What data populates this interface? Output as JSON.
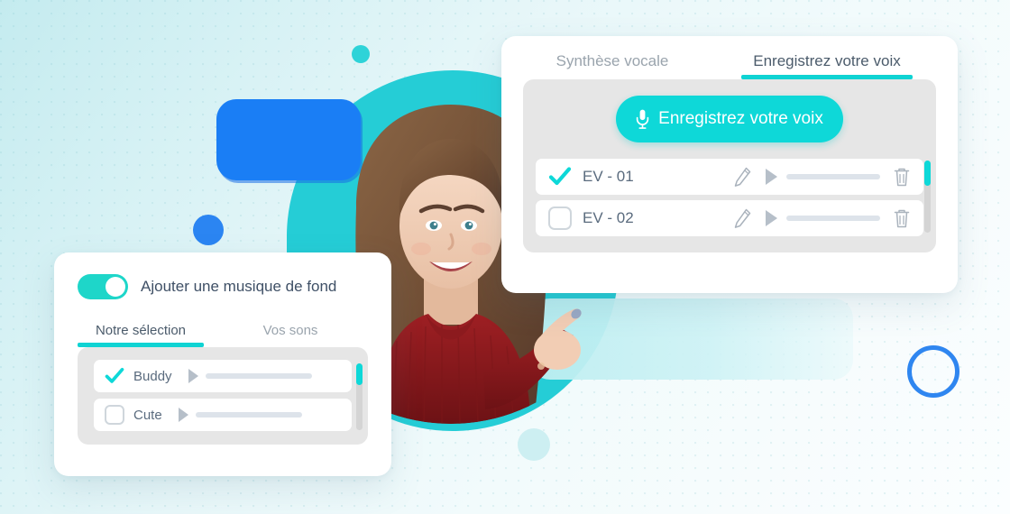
{
  "voice_card": {
    "tabs": [
      {
        "label": "Synthèse vocale",
        "active": false
      },
      {
        "label": "Enregistrez votre voix",
        "active": true
      }
    ],
    "record_button": {
      "label": "Enregistrez votre voix",
      "icon": "microphone-icon"
    },
    "rows": [
      {
        "label": "EV - 01",
        "checked": true,
        "icons": [
          "pencil-icon",
          "play-icon",
          "progress-bar",
          "trash-icon"
        ]
      },
      {
        "label": "EV - 02",
        "checked": false,
        "icons": [
          "pencil-icon",
          "play-icon",
          "progress-bar",
          "trash-icon"
        ]
      }
    ]
  },
  "music_card": {
    "toggle": {
      "label": "Ajouter une musique de fond",
      "on": true
    },
    "tabs": [
      {
        "label": "Notre sélection",
        "active": true
      },
      {
        "label": "Vos sons",
        "active": false
      }
    ],
    "rows": [
      {
        "label": "Buddy",
        "checked": true,
        "icons": [
          "play-icon",
          "progress-bar"
        ]
      },
      {
        "label": "Cute",
        "checked": false,
        "icons": [
          "play-icon",
          "progress-bar"
        ]
      }
    ]
  },
  "colors": {
    "accent_teal": "#0ed8d8",
    "blob_teal": "#25cdd6",
    "blue": "#1a7ef5",
    "text_dark": "#4b5b6b",
    "text_muted": "#9aa4ad",
    "panel_grey": "#e6e6e6",
    "background_top": "#c4ebef",
    "background_bottom": "#fbfeff"
  },
  "decor": {
    "blue_rounded_rect": "blue-rounded-rect",
    "blue_dot": "blue-dot",
    "teal_dot": "teal-dot",
    "pale_dot": "pale-dot",
    "blue_ring": "blue-ring-outline",
    "teal_blob": "teal-blob",
    "pale_panel": "pale-teal-panel",
    "portrait": "smiling-woman-pointing-photo"
  }
}
